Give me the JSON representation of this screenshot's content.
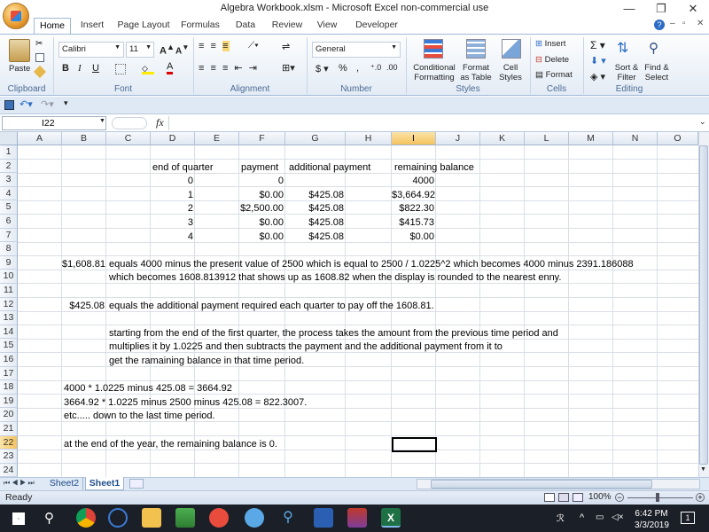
{
  "window": {
    "title": "Algebra Workbook.xlsm - Microsoft Excel non-commercial use",
    "minimize": "—",
    "restore": "❐",
    "close": "✕"
  },
  "tabs": [
    "Home",
    "Insert",
    "Page Layout",
    "Formulas",
    "Data",
    "Review",
    "View",
    "Developer"
  ],
  "ribbon": {
    "font_name": "Calibri",
    "font_size": "11",
    "number_format": "General",
    "paste_label": "Paste",
    "cond_fmt_1": "Conditional",
    "cond_fmt_2": "Formatting",
    "format_table_1": "Format",
    "format_table_2": "as Table",
    "cell_styles_1": "Cell",
    "cell_styles_2": "Styles",
    "insert_label": "Insert",
    "delete_label": "Delete",
    "format_label": "Format",
    "sort_1": "Sort &",
    "sort_2": "Filter",
    "find_1": "Find &",
    "find_2": "Select",
    "groups": [
      "Clipboard",
      "Font",
      "Alignment",
      "Number",
      "Styles",
      "Cells",
      "Editing"
    ]
  },
  "formula_bar": {
    "name_box": "I22",
    "fx": "fx",
    "value": ""
  },
  "columns": [
    "A",
    "B",
    "C",
    "D",
    "E",
    "F",
    "G",
    "H",
    "I",
    "J",
    "K",
    "L",
    "M",
    "N",
    "O"
  ],
  "selected_column": "I",
  "rows": [
    "1",
    "2",
    "3",
    "4",
    "5",
    "6",
    "7",
    "8",
    "9",
    "10",
    "11",
    "12",
    "13",
    "14",
    "15",
    "16",
    "17",
    "18",
    "19",
    "20",
    "21",
    "22",
    "23",
    "24"
  ],
  "selected_row": "22",
  "cells": {
    "d2": "end of quarter",
    "f2": "payment",
    "g2": "additional payment",
    "i2": "remaining balance",
    "d3": "0",
    "f3": "0",
    "i3": "4000",
    "d4": "1",
    "f4": "$0.00",
    "g4": "$425.08",
    "i4": "$3,664.92",
    "d5": "2",
    "f5": "$2,500.00",
    "g5": "$425.08",
    "i5": "$822.30",
    "d6": "3",
    "f6": "$0.00",
    "g6": "$425.08",
    "i6": "$415.73",
    "d7": "4",
    "f7": "$0.00",
    "g7": "$425.08",
    "i7": "$0.00",
    "b9": "$1,608.81",
    "c9": "equals 4000 minus the present value of 2500 which is equal to 2500 / 1.0225^2 which becomes 4000 minus 2391.186088",
    "c10": "which becomes 1608.813912 that shows up as 1608.82 when the display is rounded to the nearest enny.",
    "b12": "$425.08",
    "c12": "equals the additional payment required each quarter to pay off the 1608.81.",
    "c14": "starting from the end of the first quarter, the process takes the amount from the previous time period and",
    "c15": "multiplies it by 1.0225 and then subtracts the payment and the additional payment from it to",
    "c16": "get the ramaining balance in that time period.",
    "b18": "4000 * 1.0225 minus 425.08 = 3664.92",
    "b19": "3664.92 * 1.0225 minus 2500 minus 425.08 = 822.3007.",
    "b20": "etc..... down to the last time period.",
    "b22": "at the end of the year, the remaining balance is 0."
  },
  "sheets": [
    "Sheet2",
    "Sheet1"
  ],
  "active_sheet": "Sheet1",
  "status": {
    "ready": "Ready",
    "zoom": "100%"
  },
  "taskbar": {
    "time": "6:42 PM",
    "date": "3/3/2019",
    "notifications": "1"
  },
  "colors": {
    "accent": "#2b579a",
    "excel_green": "#1e7145",
    "selected_header": "#f4c35e"
  }
}
